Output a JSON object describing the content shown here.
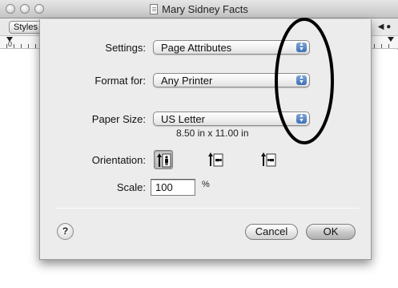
{
  "window": {
    "title": "Mary Sidney Facts",
    "toolbar": {
      "styles_label": "Styles"
    },
    "ruler": {
      "zero_label": "0"
    }
  },
  "dialog": {
    "settings": {
      "label": "Settings:",
      "value": "Page Attributes"
    },
    "format_for": {
      "label": "Format for:",
      "value": "Any Printer"
    },
    "paper_size": {
      "label": "Paper Size:",
      "value": "US Letter",
      "dimensions": "8.50 in x 11.00 in"
    },
    "orientation": {
      "label": "Orientation:",
      "options": [
        "portrait",
        "landscape-left",
        "landscape-right"
      ],
      "selected": "portrait"
    },
    "scale": {
      "label": "Scale:",
      "value": "100",
      "unit": "%"
    },
    "buttons": {
      "help": "?",
      "cancel": "Cancel",
      "ok": "OK"
    }
  },
  "colors": {
    "dialog_bg": "#ececec",
    "popup_arrow_accent": "#3d6fb7",
    "annotation_stroke": "#000000"
  }
}
